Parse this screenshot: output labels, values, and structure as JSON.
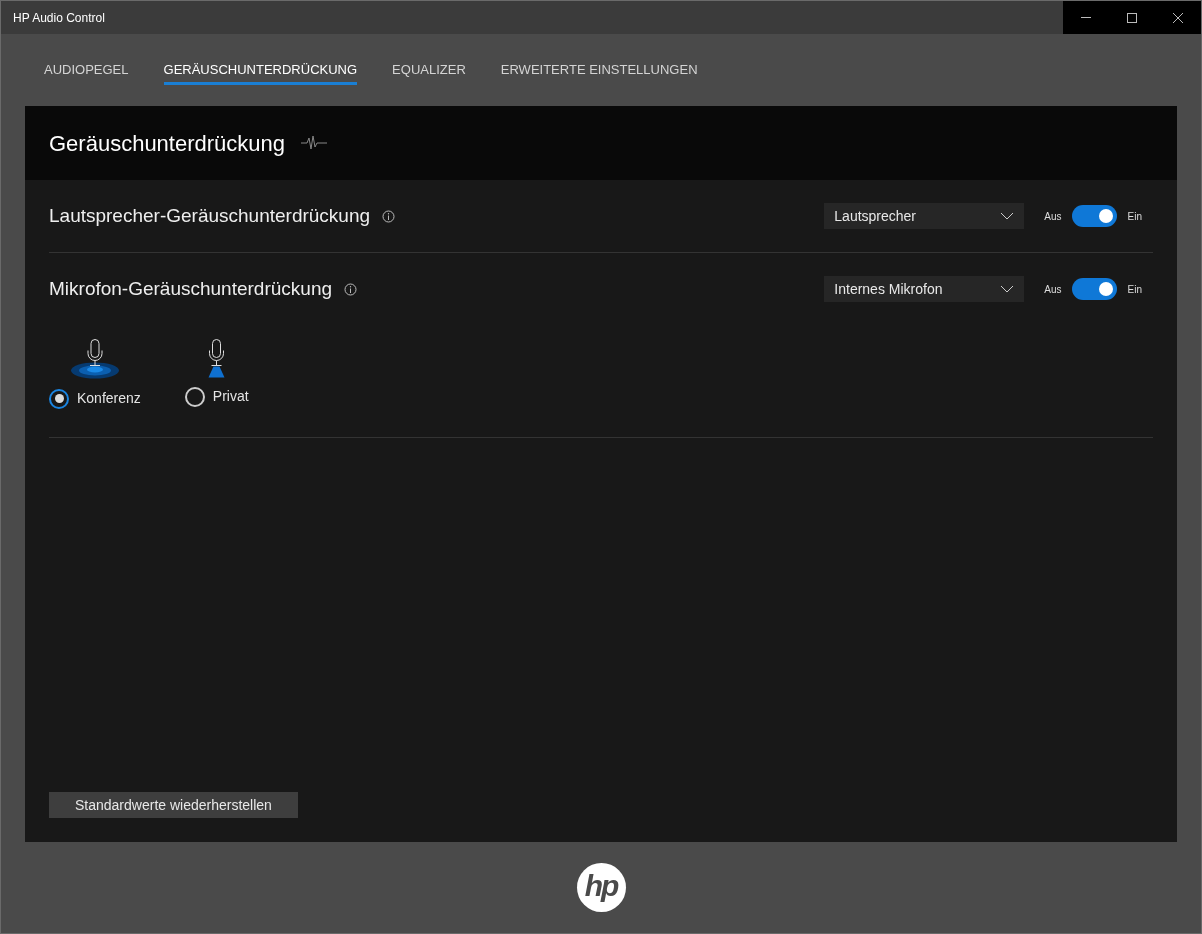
{
  "window": {
    "title": "HP Audio Control"
  },
  "tabs": [
    {
      "label": "AUDIOPEGEL",
      "selected": false
    },
    {
      "label": "GERÄUSCHUNTERDRÜCKUNG",
      "selected": true
    },
    {
      "label": "EQUALIZER",
      "selected": false
    },
    {
      "label": "ERWEITERTE EINSTELLUNGEN",
      "selected": false
    }
  ],
  "panel": {
    "title": "Geräuschunterdrückung",
    "sections": [
      {
        "label": "Lautsprecher-Geräuschunterdrückung",
        "dropdown": "Lautsprecher",
        "off_label": "Aus",
        "on_label": "Ein",
        "on": true
      },
      {
        "label": "Mikrofon-Geräuschunterdrückung",
        "dropdown": "Internes Mikrofon",
        "off_label": "Aus",
        "on_label": "Ein",
        "on": true,
        "modes": [
          {
            "kind": "conference",
            "label": "Konferenz",
            "selected": true
          },
          {
            "kind": "private",
            "label": "Privat",
            "selected": false
          }
        ]
      }
    ],
    "reset_button": "Standardwerte wiederherstellen"
  },
  "logo": {
    "text": "hp"
  }
}
